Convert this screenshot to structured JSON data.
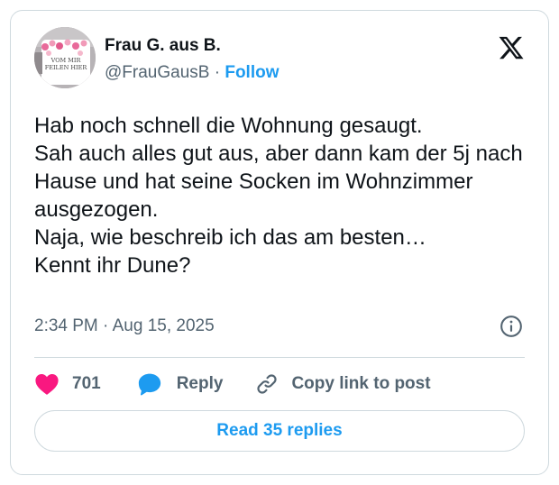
{
  "author": {
    "name": "Frau G. aus B.",
    "handle": "@FrauGausB",
    "separator": "·",
    "follow_label": "Follow",
    "avatar_icon": "profile-photo-mug",
    "avatar_mug_text_line1": "VOM MIR",
    "avatar_mug_text_line2": "FEILEN HIER"
  },
  "platform_icon": "x-logo-icon",
  "tweet": {
    "text": "Hab noch schnell die Wohnung gesaugt.\nSah auch alles gut aus, aber dann kam der 5j nach Hause und hat seine Socken im Wohnzimmer ausgezogen.\nNaja, wie beschreib ich das am besten…\nKennt ihr Dune?",
    "time": "2:34 PM",
    "meta_separator": "·",
    "date": "Aug 15, 2025"
  },
  "actions": {
    "like_count": "701",
    "reply_label": "Reply",
    "copy_link_label": "Copy link to post"
  },
  "read_replies_label": "Read 35 replies",
  "colors": {
    "accent": "#1d9bf0",
    "like": "#f91880",
    "text": "#0f1419",
    "muted": "#536471",
    "border": "#cfd9de"
  }
}
